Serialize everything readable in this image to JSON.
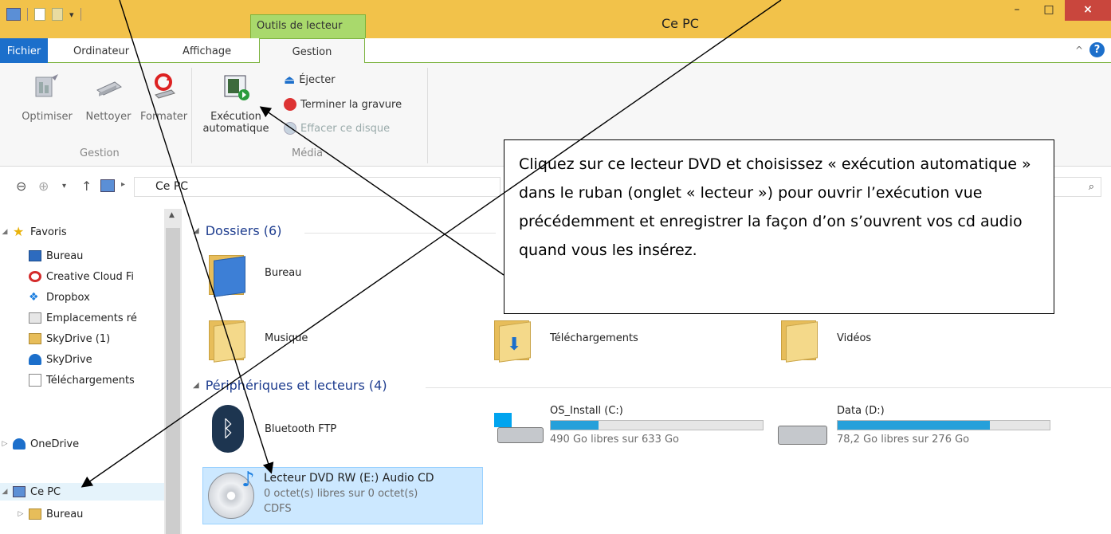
{
  "window": {
    "title": "Ce PC",
    "context_tab": "Outils de lecteur",
    "controls": {
      "minimize": "–",
      "maximize": "□",
      "close": "×"
    }
  },
  "tabs": {
    "file": "Fichier",
    "computer": "Ordinateur",
    "view": "Affichage",
    "manage": "Gestion"
  },
  "ribbon": {
    "optimize": "Optimiser",
    "cleanup": "Nettoyer",
    "format": "Formater",
    "group_manage": "Gestion",
    "autoplay_line1": "Exécution",
    "autoplay_line2": "automatique",
    "eject": "Éjecter",
    "finish_burning": "Terminer la gravure",
    "erase_disc": "Effacer ce disque",
    "group_media": "Média"
  },
  "address": {
    "path": "Ce PC"
  },
  "sidebar": {
    "favorites": "Favoris",
    "items": [
      "Bureau",
      "Creative Cloud Fi",
      "Dropbox",
      "Emplacements ré",
      "SkyDrive (1)",
      "SkyDrive",
      "Téléchargements"
    ],
    "onedrive": "OneDrive",
    "this_pc": "Ce PC",
    "pc_items": [
      "Bureau"
    ]
  },
  "main": {
    "folders_header": "Dossiers (6)",
    "folders": [
      "Bureau",
      "Musique",
      "Téléchargements",
      "Vidéos"
    ],
    "devices_header": "Périphériques et lecteurs (4)",
    "bluetooth": "Bluetooth FTP",
    "drive_c": {
      "name": "OS_Install (C:)",
      "free": "490 Go libres sur 633 Go",
      "used_fraction": 0.226
    },
    "drive_d": {
      "name": "Data (D:)",
      "free": "78,2 Go libres sur 276 Go",
      "used_fraction": 0.717
    },
    "dvd": {
      "name": "Lecteur DVD RW (E:) Audio CD",
      "free": "0 octet(s) libres sur 0 octet(s)",
      "fs": "CDFS"
    }
  },
  "callout": {
    "text": "Cliquez sur ce lecteur DVD et choisissez « exécution automatique » dans le ruban (onglet « lecteur ») pour ouvrir l’exécution vue précédemment et enregistrer la façon d’on s’ouvrent vos cd audio quand vous les insérez."
  },
  "colors": {
    "title_bar": "#f2c24a",
    "context_tab": "#a9d96c",
    "file_tab": "#1c6fcb",
    "drive_bar": "#26a0da",
    "selection": "#cce8ff"
  }
}
